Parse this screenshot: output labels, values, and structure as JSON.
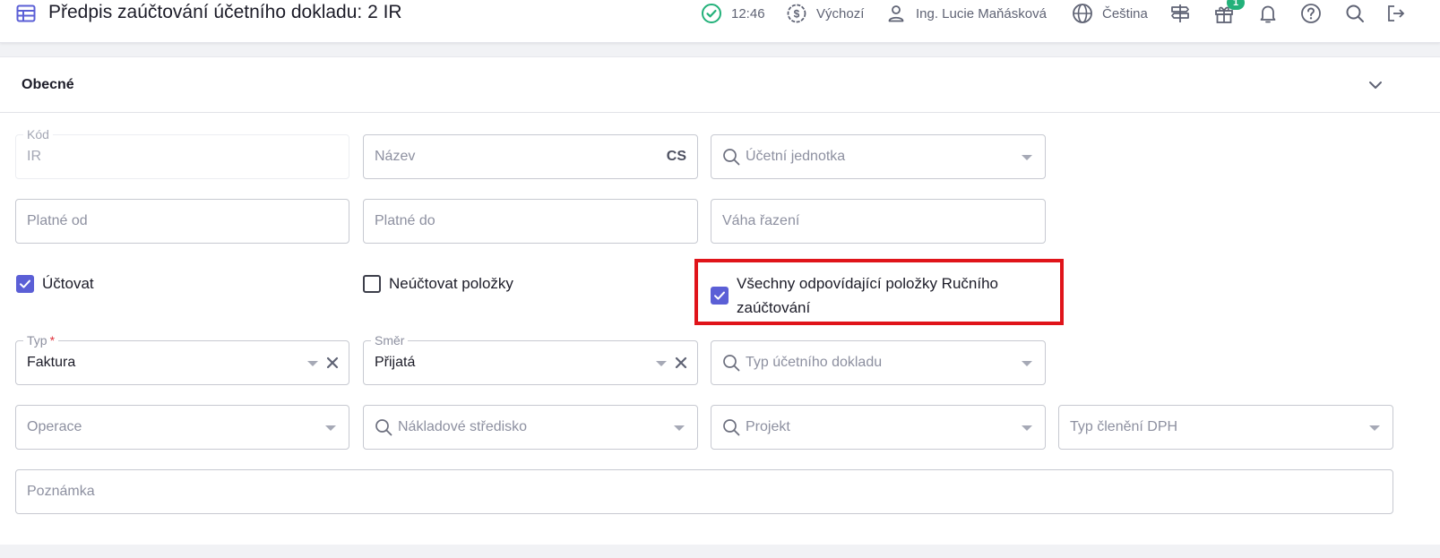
{
  "header": {
    "title": "Předpis zaúčtování účetního dokladu: 2 IR",
    "time": "12:46",
    "currency_profile": "Výchozí",
    "user": "Ing. Lucie Maňásková",
    "language": "Čeština",
    "gift_badge": "1",
    "icons": [
      "table-icon",
      "check-circle-icon",
      "dollar-gear-icon",
      "user-icon",
      "globe-icon",
      "signpost-icon",
      "gift-icon",
      "bell-icon",
      "help-icon",
      "search-icon",
      "logout-icon"
    ]
  },
  "panel": {
    "title": "Obecné"
  },
  "fields": {
    "kod": {
      "label": "Kód",
      "value": "IR"
    },
    "nazev": {
      "placeholder": "Název",
      "lang": "CS"
    },
    "ucetni_jednotka": {
      "placeholder": "Účetní jednotka"
    },
    "platne_od": {
      "placeholder": "Platné od"
    },
    "platne_do": {
      "placeholder": "Platné do"
    },
    "vaha_razeni": {
      "placeholder": "Váha řazení"
    },
    "typ": {
      "label": "Typ",
      "required_mark": "*",
      "value": "Faktura"
    },
    "smer": {
      "label": "Směr",
      "value": "Přijatá"
    },
    "typ_dokladu": {
      "placeholder": "Typ účetního dokladu"
    },
    "operace": {
      "placeholder": "Operace"
    },
    "nakladove_stredisko": {
      "placeholder": "Nákladové středisko"
    },
    "projekt": {
      "placeholder": "Projekt"
    },
    "typ_cleneni_dph": {
      "placeholder": "Typ členění DPH"
    },
    "poznamka": {
      "placeholder": "Poznámka"
    }
  },
  "checkboxes": {
    "uctovat": {
      "label": "Účtovat",
      "checked": true
    },
    "neuctovat_polozky": {
      "label": "Neúčtovat položky",
      "checked": false
    },
    "vsechny_polozky": {
      "label_line1": "Všechny odpovídající položky Ručního",
      "label_line2": "zaúčtování",
      "checked": true
    }
  },
  "colors": {
    "accent": "#5b5fd6",
    "highlight": "#e0141a",
    "badge": "#23b17a",
    "status_ok": "#23b17a"
  }
}
